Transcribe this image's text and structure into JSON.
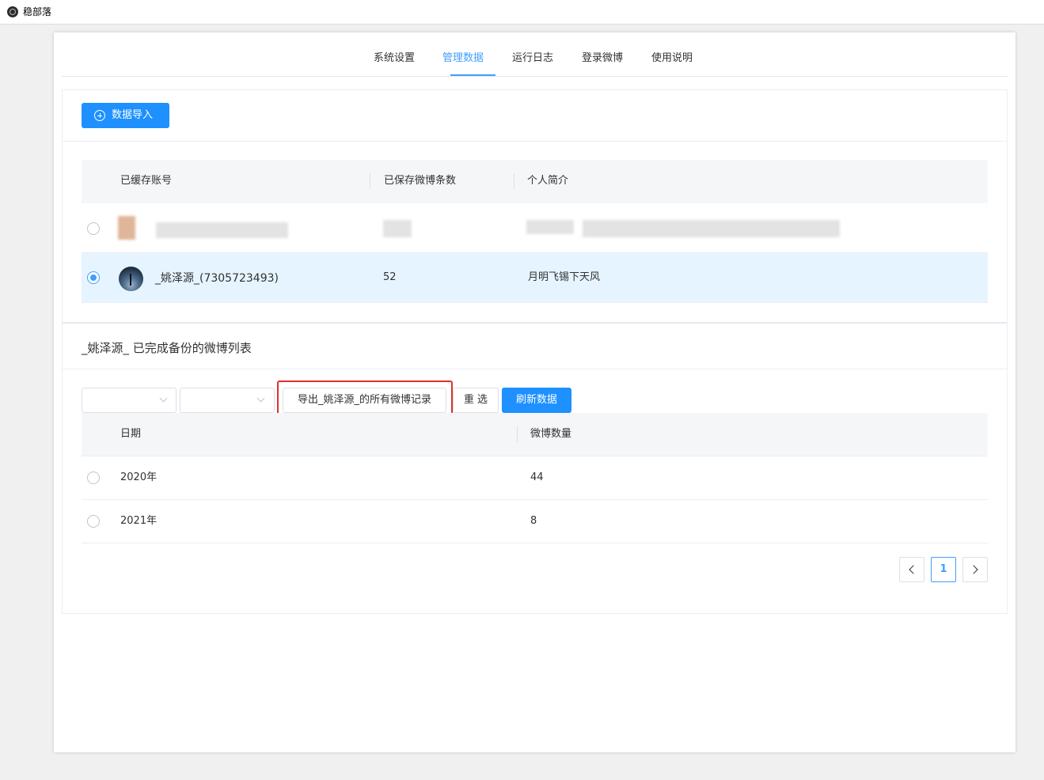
{
  "window": {
    "app_icon": "electron-icon",
    "title": "稳部落"
  },
  "tabs": [
    {
      "label": "系统设置",
      "active": false
    },
    {
      "label": "管理数据",
      "active": true
    },
    {
      "label": "运行日志",
      "active": false
    },
    {
      "label": "登录微博",
      "active": false
    },
    {
      "label": "使用说明",
      "active": false
    }
  ],
  "toolbar": {
    "import_label": "数据导入",
    "import_icon": "plus-circle-icon"
  },
  "accounts_table": {
    "headers": [
      "已缓存账号",
      "已保存微博条数",
      "个人简介"
    ],
    "rows": [
      {
        "account": "",
        "count": "",
        "bio": "",
        "selected": false,
        "blurred": true
      },
      {
        "account": "_姚泽源_(7305723493)",
        "count": "52",
        "bio": "月明飞锡下天风",
        "selected": true,
        "blurred": false
      }
    ]
  },
  "backup_section": {
    "title": "_姚泽源_ 已完成备份的微博列表",
    "filters": {
      "year_value": "",
      "month_value": ""
    },
    "export_label": "导出_姚泽源_的所有微博记录",
    "reset_label": "重 选",
    "refresh_label": "刷新数据"
  },
  "posts_table": {
    "headers": [
      "日期",
      "微博数量"
    ],
    "rows": [
      {
        "date": "2020年",
        "count": "44"
      },
      {
        "date": "2021年",
        "count": "8"
      }
    ]
  },
  "pagination": {
    "current_page": "1"
  },
  "colors": {
    "accent": "#409eff",
    "primary_button": "#1e90ff",
    "highlight": "#e0302a",
    "selected_row": "#e6f4ff"
  }
}
